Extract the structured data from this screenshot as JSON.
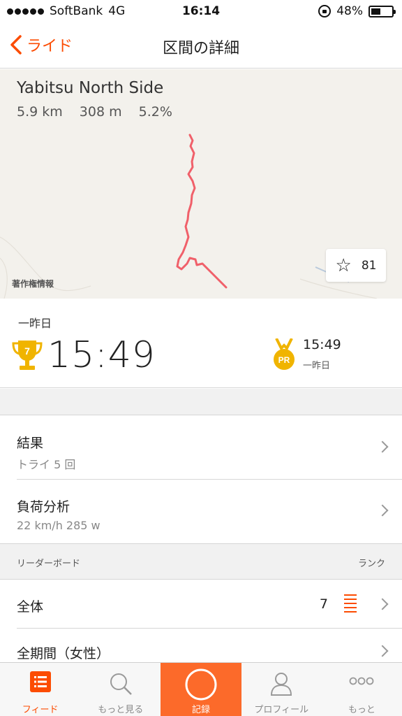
{
  "status_bar": {
    "carrier": "SoftBank",
    "network": "4G",
    "time": "16:14",
    "battery": "48%",
    "battery_level": 0.48
  },
  "nav": {
    "back_label": "ライド",
    "title": "区間の詳細"
  },
  "segment": {
    "name": "Yabitsu North Side",
    "distance": "5.9 km",
    "elevation": "308 m",
    "grade": "5.2%",
    "map_credit": "著作権情報",
    "star_count": "81"
  },
  "result": {
    "date": "一昨日",
    "trophy_rank": "7",
    "time": "15:49",
    "pr_badge": "PR",
    "pr_time": "15:49",
    "pr_date": "一昨日"
  },
  "rows": {
    "results": {
      "title": "結果",
      "sub": "トライ 5 回"
    },
    "analysis": {
      "title": "負荷分析",
      "sub": "22 km/h 285 w"
    }
  },
  "leaderboard": {
    "header": "リーダーボード",
    "rank_header": "ランク",
    "overall": {
      "title": "全体",
      "rank": "7"
    },
    "women": {
      "title": "全期間（女性）"
    }
  },
  "tabs": [
    {
      "label": "フィード",
      "icon": "feed-icon"
    },
    {
      "label": "もっと見る",
      "icon": "search-icon"
    },
    {
      "label": "記録",
      "icon": "record-icon"
    },
    {
      "label": "プロフィール",
      "icon": "profile-icon"
    },
    {
      "label": "もっと",
      "icon": "more-icon"
    }
  ],
  "colors": {
    "accent": "#fc4c02",
    "route": "#f0606a",
    "trophy": "#f0b400"
  }
}
